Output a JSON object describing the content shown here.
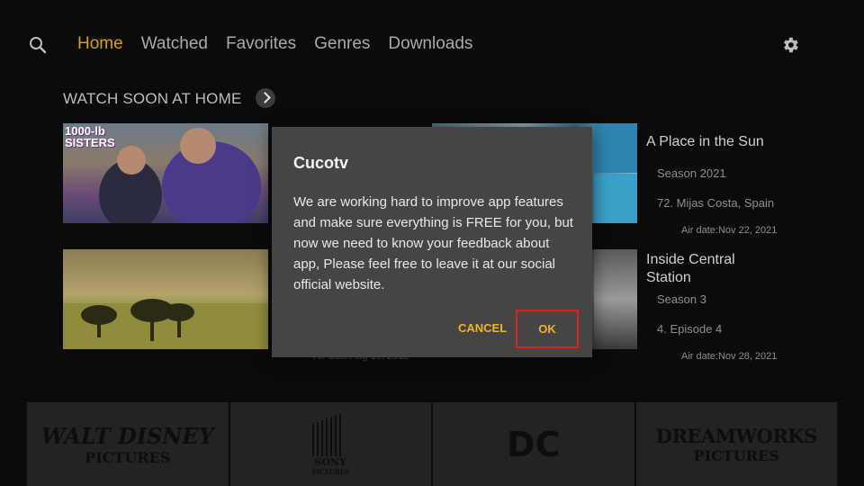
{
  "nav": {
    "tabs": [
      {
        "label": "Home",
        "active": true
      },
      {
        "label": "Watched"
      },
      {
        "label": "Favorites"
      },
      {
        "label": "Genres"
      },
      {
        "label": "Downloads"
      }
    ]
  },
  "section": {
    "title": "WATCH SOON AT HOME"
  },
  "cards": {
    "card1": {
      "image_text": "1000-lb SISTERS"
    },
    "card3": {
      "title": "A Place in the Sun",
      "season": "Season 2021",
      "episode": "72. Mijas Costa, Spain",
      "air_date": "Air date:Nov 22, 2021"
    },
    "card4": {
      "title_line1": "Inside Central",
      "title_line2": "Station",
      "season": "Season 3",
      "episode": "4. Episode 4",
      "air_date": "Air date:Nov 28, 2021"
    },
    "partial_air_date": "Air date:Aug 10, 2012"
  },
  "studios": [
    {
      "line1": "WALT DISNEY",
      "line2": "PICTURES"
    },
    {
      "line1": "SONY",
      "line2": "PICTURES"
    },
    {
      "line1": "DC",
      "line2": ""
    },
    {
      "line1": "DREAMWORKS",
      "line2": "PICTURES"
    }
  ],
  "dialog": {
    "title": "Cucotv",
    "message": "We are working hard to improve app features and make sure everything is FREE for you, but now we need to know your feedback about app, Please feel free to leave it at our social official website.",
    "cancel_label": "CANCEL",
    "ok_label": "OK"
  },
  "colors": {
    "accent": "#d4a017",
    "dialog_button": "#f0b429",
    "highlight_border": "#e02020"
  }
}
